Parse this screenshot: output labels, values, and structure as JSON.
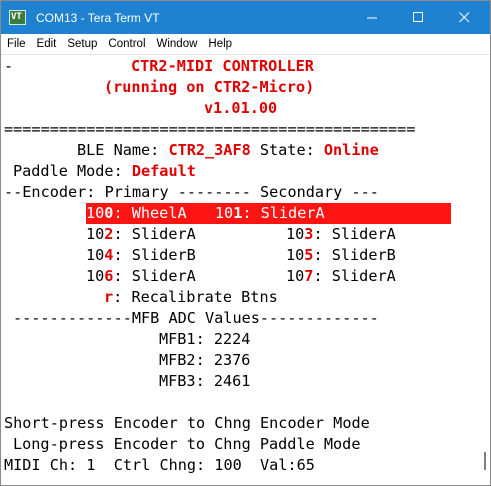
{
  "window": {
    "title": "COM13 - Tera Term VT",
    "icon_text": "VT",
    "controls": {
      "minimize": "—",
      "maximize": "☐",
      "close": "✕"
    }
  },
  "menu": [
    "File",
    "Edit",
    "Setup",
    "Control",
    "Window",
    "Help"
  ],
  "terminal": {
    "cursor_mark": "-",
    "header_title": "CTR2-MIDI CONTROLLER",
    "header_sub": "(running on CTR2-Micro)",
    "version": "v1.01.00",
    "separator": "=============================================",
    "ble_label": "BLE Name: ",
    "ble_name": "CTR2_3AF8",
    "state_label": " State: ",
    "state_value": "Online",
    "paddle_label": "Paddle Mode: ",
    "paddle_value": "Default",
    "encoder_header": "--Encoder: Primary -------- Secondary ---",
    "enc_row1": {
      "p_prefix": "10",
      "p_digit": "0",
      "p_name": ": WheelA  ",
      "s_prefix": "10",
      "s_digit": "1",
      "s_name": ": SliderA"
    },
    "enc_row2": {
      "p_prefix": "10",
      "p_digit": "2",
      "p_name": ": SliderA",
      "s_prefix": "10",
      "s_digit": "3",
      "s_name": ": SliderA"
    },
    "enc_row3": {
      "p_prefix": "10",
      "p_digit": "4",
      "p_name": ": SliderB",
      "s_prefix": "10",
      "s_digit": "5",
      "s_name": ": SliderB"
    },
    "enc_row4": {
      "p_prefix": "10",
      "p_digit": "6",
      "p_name": ": SliderA",
      "s_prefix": "10",
      "s_digit": "7",
      "s_name": ": SliderA"
    },
    "recal_key": "r",
    "recal_text": ": Recalibrate Btns",
    "mfb_header": "-------------MFB ADC Values-------------",
    "mfb1": "MFB1: 2224",
    "mfb2": "MFB2: 2376",
    "mfb3": "MFB3: 2461",
    "help1": "Short-press Encoder to Chng Encoder Mode",
    "help2": "Long-press Encoder to Chng Paddle Mode",
    "status": "MIDI Ch: 1  Ctrl Chng: 100  Val:65"
  }
}
